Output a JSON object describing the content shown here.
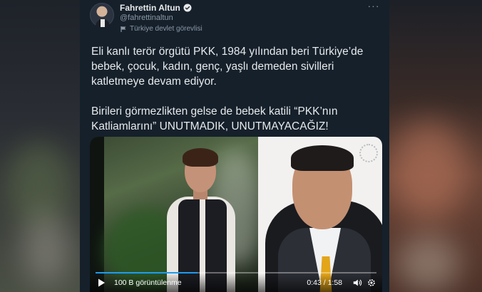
{
  "author": {
    "name": "Fahrettin Altun",
    "handle": "@fahrettinaltun",
    "label": "Türkiye devlet görevlisi",
    "verified_icon": "verified-badge-icon",
    "label_icon": "flag-icon"
  },
  "tweet": {
    "paragraph1": "Eli kanlı terör örgütü PKK, 1984 yılından beri Türkiye’de bebek, çocuk, kadın, genç, yaşlı demeden sivilleri katletmeye devam ediyor.",
    "paragraph2": "Birileri görmezlikten gelse de bebek katili “PKK’nın Katliamlarını” UNUTMADIK, UNUTMAYACAĞIZ!"
  },
  "video": {
    "views": "100 B görüntülenme",
    "time": "0:43 / 1:58",
    "progress_fraction": 0.364,
    "accent": "#1d9bf0"
  },
  "colors": {
    "background": "#15202b",
    "text": "#e7e9ea",
    "muted": "#8b98a5"
  }
}
